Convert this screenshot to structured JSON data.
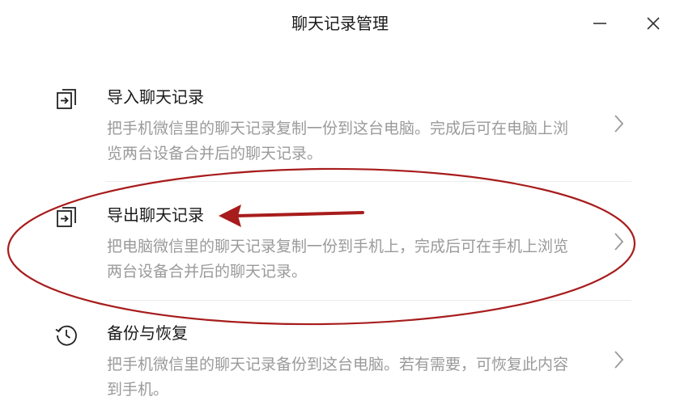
{
  "window": {
    "title": "聊天记录管理",
    "minimize_icon": "minimize-icon",
    "close_icon": "close-icon"
  },
  "items": [
    {
      "icon": "import-icon",
      "title": "导入聊天记录",
      "description": "把手机微信里的聊天记录复制一份到这台电脑。完成后可在电脑上浏览两台设备合并后的聊天记录。"
    },
    {
      "icon": "export-icon",
      "title": "导出聊天记录",
      "description": "把电脑微信里的聊天记录复制一份到手机上，完成后可在手机上浏览两台设备合并后的聊天记录。"
    },
    {
      "icon": "history-icon",
      "title": "备份与恢复",
      "description": "把手机微信里的聊天记录备份到这台电脑。若有需要，可恢复此内容到手机。"
    }
  ],
  "annotation": {
    "color": "#a81c1c",
    "shape": "ellipse-around-export-with-arrow"
  }
}
